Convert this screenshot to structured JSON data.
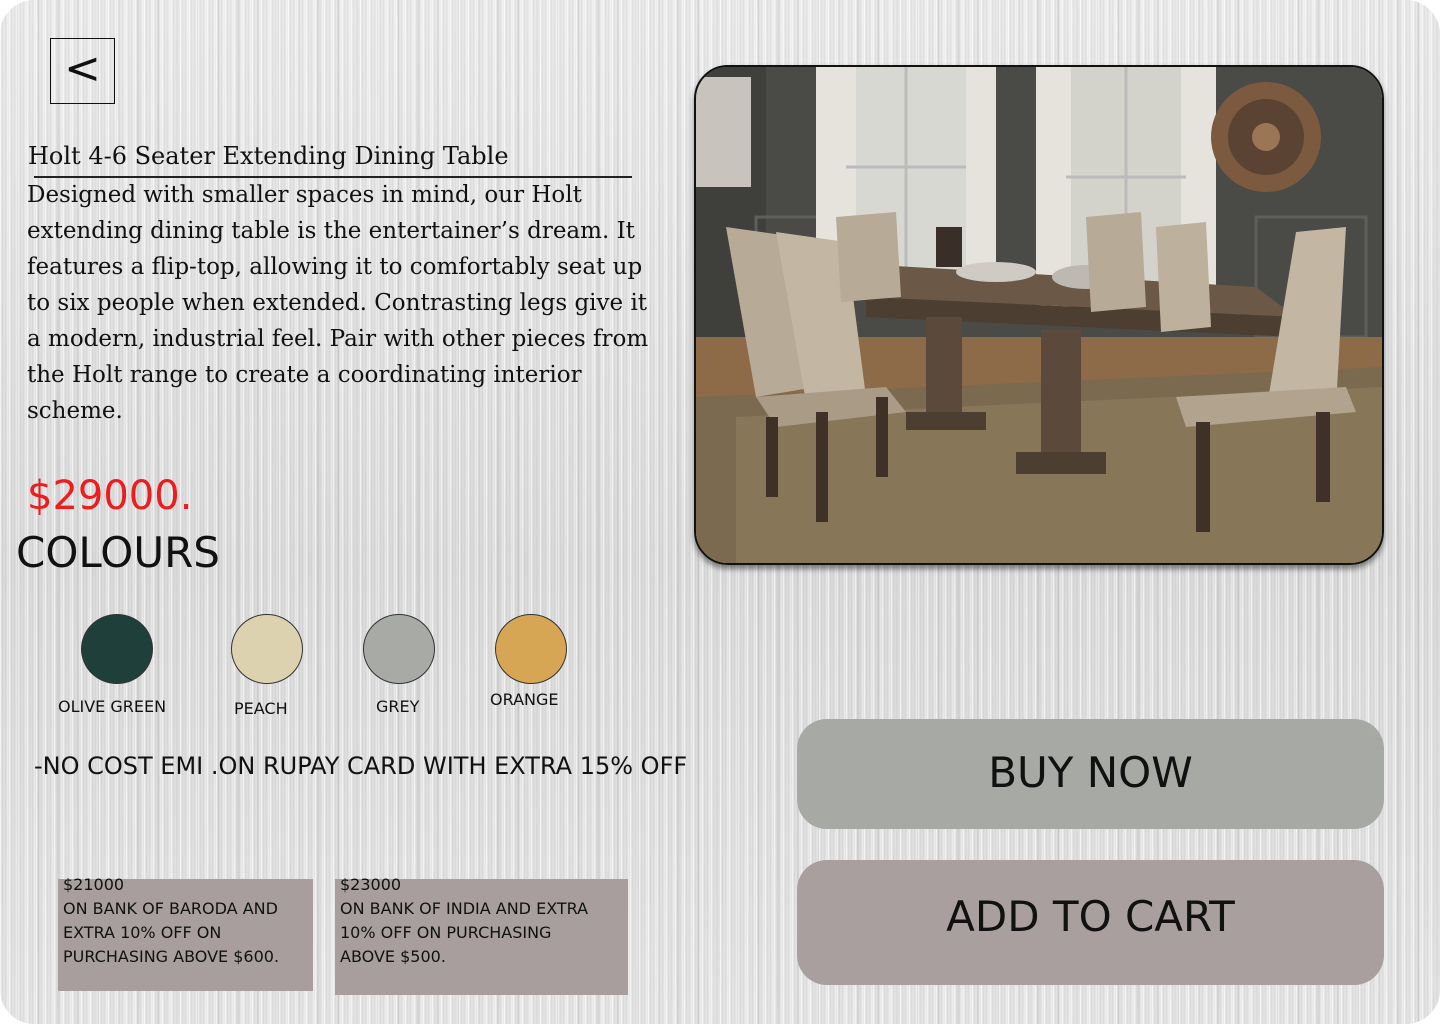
{
  "nav": {
    "back_label": "<"
  },
  "product": {
    "title": "Holt 4-6 Seater Extending Dining Table",
    "description": "Designed with smaller spaces in mind, our Holt extending dining table is the entertainer’s dream. It features a flip-top, allowing it to comfortably seat up to six people when extended. Contrasting legs give it a modern, industrial feel. Pair with other pieces from the Holt range to create a coordinating interior scheme.",
    "price": "$29000."
  },
  "colours": {
    "heading": "COLOURS",
    "options": [
      {
        "label": "OLIVE GREEN",
        "color": "#1f3f3a"
      },
      {
        "label": "PEACH",
        "color": "#ddd2b0"
      },
      {
        "label": "GREY",
        "color": "#a8aaa6"
      },
      {
        "label": "ORANGE",
        "color": "#d7a655"
      }
    ]
  },
  "emi_text": "-NO COST EMI .ON RUPAY CARD WITH EXTRA 15% OFF",
  "offers": [
    {
      "lines": [
        "$21000",
        "ON BANK OF BARODA AND",
        "EXTRA 10% OFF ON",
        "PURCHASING ABOVE $600."
      ]
    },
    {
      "lines": [
        "$23000",
        "ON BANK OF INDIA AND EXTRA",
        "10% OFF ON PURCHASING",
        "ABOVE $500."
      ]
    }
  ],
  "actions": {
    "buy_now": "BUY NOW",
    "add_to_cart": "ADD TO CART"
  },
  "image": {
    "subject": "dining-table-photo"
  }
}
